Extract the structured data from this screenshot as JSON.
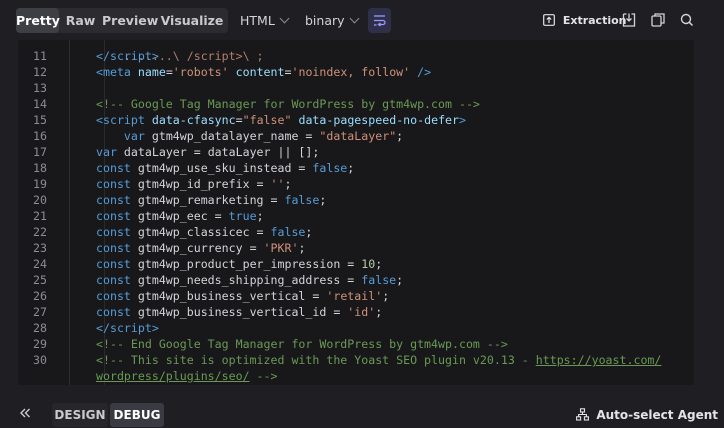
{
  "toolbar": {
    "tabs": [
      {
        "label": "Pretty",
        "active": true
      },
      {
        "label": "Raw",
        "active": false
      },
      {
        "label": "Preview",
        "active": false
      },
      {
        "label": "Visualize",
        "active": false
      }
    ],
    "format_select": "HTML",
    "encoding_select": "binary",
    "extraction_label": "Extraction"
  },
  "code": {
    "partial_top_line": "    .......\\ /script>\\ ;",
    "lines": [
      {
        "n": "11",
        "html": "<span class=\"tag\">&lt;/script&gt;</span>"
      },
      {
        "n": "12",
        "html": "<span class=\"tag\">&lt;meta</span> <span class=\"attr\">name</span>=<span class=\"str\">'robots'</span> <span class=\"attr\">content</span>=<span class=\"str\">'noindex, follow'</span> <span class=\"tag\">/&gt;</span>"
      },
      {
        "n": "13",
        "html": ""
      },
      {
        "n": "14",
        "html": "<span class=\"cm\">&lt;!-- Google Tag Manager for WordPress by gtm4wp.com --&gt;</span>"
      },
      {
        "n": "15",
        "html": "<span class=\"tag\">&lt;script</span> <span class=\"attr\">data-cfasync</span>=<span class=\"str\">\"false\"</span> <span class=\"attr\">data-pagespeed-no-defer</span><span class=\"tag\">&gt;</span>"
      },
      {
        "n": "16",
        "html": "    <span class=\"kw\">var</span> gtm4wp_datalayer_name = <span class=\"str\">\"dataLayer\"</span>;"
      },
      {
        "n": "17",
        "html": "<span class=\"kw\">var</span> dataLayer = dataLayer || [];"
      },
      {
        "n": "18",
        "html": "<span class=\"kw\">const</span> gtm4wp_use_sku_instead = <span class=\"kw\">false</span>;"
      },
      {
        "n": "19",
        "html": "<span class=\"kw\">const</span> gtm4wp_id_prefix = <span class=\"str\">''</span>;"
      },
      {
        "n": "20",
        "html": "<span class=\"kw\">const</span> gtm4wp_remarketing = <span class=\"kw\">false</span>;"
      },
      {
        "n": "21",
        "html": "<span class=\"kw\">const</span> gtm4wp_eec = <span class=\"kw\">true</span>;"
      },
      {
        "n": "22",
        "html": "<span class=\"kw\">const</span> gtm4wp_classicec = <span class=\"kw\">false</span>;"
      },
      {
        "n": "23",
        "html": "<span class=\"kw\">const</span> gtm4wp_currency = <span class=\"str\">'PKR'</span>;"
      },
      {
        "n": "24",
        "html": "<span class=\"kw\">const</span> gtm4wp_product_per_impression = <span class=\"num\">10</span>;"
      },
      {
        "n": "25",
        "html": "<span class=\"kw\">const</span> gtm4wp_needs_shipping_address = <span class=\"kw\">false</span>;"
      },
      {
        "n": "26",
        "html": "<span class=\"kw\">const</span> gtm4wp_business_vertical = <span class=\"str\">'retail'</span>;"
      },
      {
        "n": "27",
        "html": "<span class=\"kw\">const</span> gtm4wp_business_vertical_id = <span class=\"str\">'id'</span>;"
      },
      {
        "n": "28",
        "html": "<span class=\"tag\">&lt;/script&gt;</span>"
      },
      {
        "n": "29",
        "html": "<span class=\"cm\">&lt;!-- End Google Tag Manager for WordPress by gtm4wp.com --&gt;</span>"
      },
      {
        "n": "30",
        "html": "<span class=\"cm\">&lt;!-- This site is optimized with the Yoast SEO plugin v20.13 - <span class=\"lnk\">https://yoast.com/</span></span>"
      },
      {
        "n": "",
        "html": "<span class=\"cm\"><span class=\"lnk\">wordpress/plugins/seo/</span> --&gt;</span>"
      }
    ]
  },
  "footer": {
    "modes": [
      {
        "label": "DESIGN",
        "active": false
      },
      {
        "label": "DEBUG",
        "active": true
      }
    ],
    "agent_label": "Auto-select Agent"
  }
}
